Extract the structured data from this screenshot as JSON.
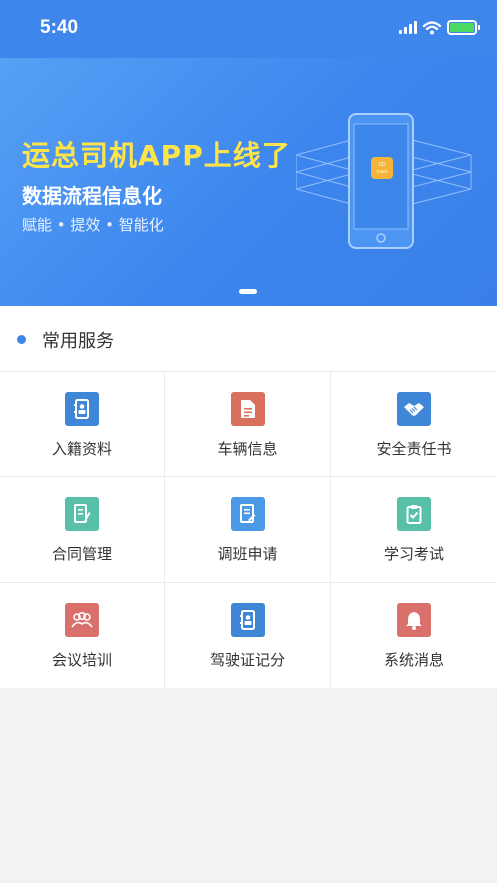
{
  "status_bar": {
    "time": "5:40"
  },
  "banner": {
    "title": "运总司机APP上线了",
    "subtitle": "数据流程信息化",
    "tags": "赋能 • 提效 • 智能化",
    "phone_badge_top": "CD",
    "phone_badge_bottom": "Track"
  },
  "section": {
    "title": "常用服务"
  },
  "services": [
    {
      "label": "入籍资料",
      "icon": "contact-book-icon",
      "color": "#3f86d6"
    },
    {
      "label": "车辆信息",
      "icon": "document-icon",
      "color": "#d9705e"
    },
    {
      "label": "安全责任书",
      "icon": "handshake-icon",
      "color": "#3f86d6"
    },
    {
      "label": "合同管理",
      "icon": "contract-edit-icon",
      "color": "#58c0a8"
    },
    {
      "label": "调班申请",
      "icon": "shift-request-icon",
      "color": "#4a98e6"
    },
    {
      "label": "学习考试",
      "icon": "clipboard-check-icon",
      "color": "#58c0a8"
    },
    {
      "label": "会议培训",
      "icon": "group-icon",
      "color": "#d9706b"
    },
    {
      "label": "驾驶证记分",
      "icon": "contact-book-icon",
      "color": "#3f86d6"
    },
    {
      "label": "系统消息",
      "icon": "bell-icon",
      "color": "#d9706b"
    }
  ]
}
